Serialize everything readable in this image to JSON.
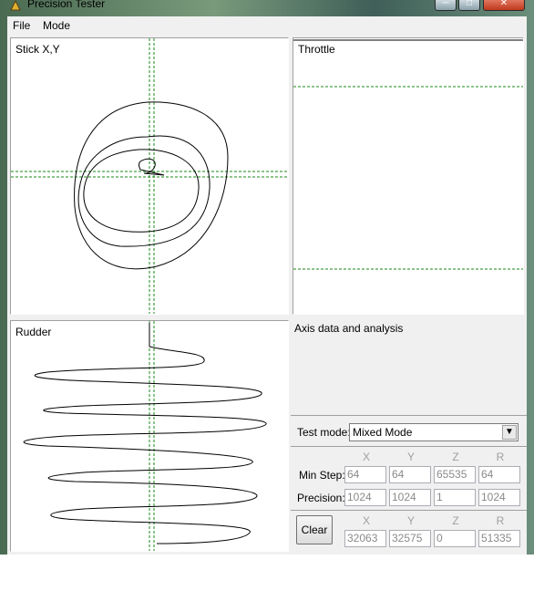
{
  "window": {
    "title": "Precision Tester"
  },
  "menu": [
    {
      "label": "File"
    },
    {
      "label": "Mode"
    }
  ],
  "panels": {
    "stick": {
      "label": "Stick X,Y"
    },
    "throttle": {
      "label": "Throttle"
    },
    "rudder": {
      "label": "Rudder"
    }
  },
  "analysis": {
    "label": "Axis data and analysis"
  },
  "test_mode": {
    "label": "Test mode:",
    "value": "Mixed Mode"
  },
  "columns": [
    "X",
    "Y",
    "Z",
    "R"
  ],
  "min_step": {
    "label": "Min Step:",
    "values": [
      "64",
      "64",
      "65535",
      "64"
    ]
  },
  "precision": {
    "label": "Precision:",
    "values": [
      "1024",
      "1024",
      "1",
      "1024"
    ]
  },
  "current": {
    "clear_label": "Clear",
    "values": [
      "32063",
      "32575",
      "0",
      "51335"
    ]
  },
  "colors": {
    "guide_line": "#1a8a1a",
    "trace": "#000000",
    "panel_bg": "#ffffff",
    "dialog_bg": "#f0f0f0"
  }
}
